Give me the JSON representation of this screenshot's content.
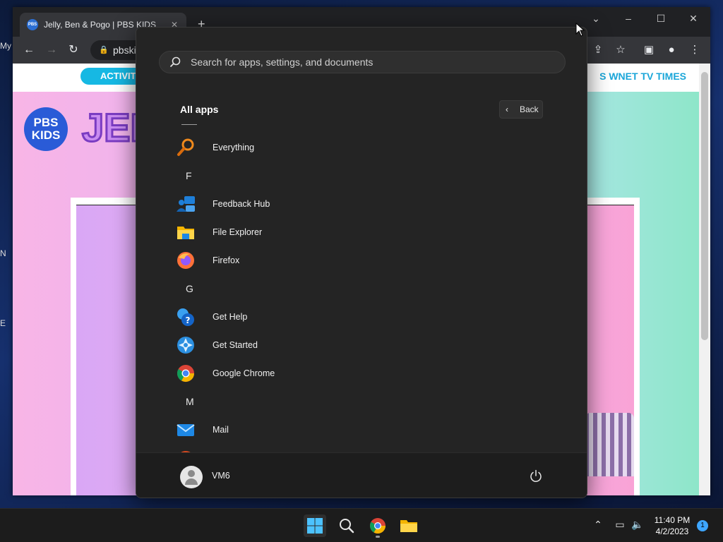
{
  "desktop": {
    "fragments": [
      "My",
      "N",
      "E"
    ]
  },
  "browser": {
    "tab_title": "Jelly, Ben & Pogo | PBS KIDS",
    "url": "pbski",
    "page": {
      "activity_pill": "ACTIVIT",
      "nav_right": "S  WNET  TV TIMES",
      "logo_text": "PBS KIDS",
      "game_title": "JELL & "
    }
  },
  "start_menu": {
    "search_placeholder": "Search for apps, settings, and documents",
    "heading": "All apps",
    "back_label": "Back",
    "apps": [
      {
        "name": "Everything",
        "icon": "magnifier-icon"
      },
      {
        "letter": "F"
      },
      {
        "name": "Feedback Hub",
        "icon": "feedback-hub-icon"
      },
      {
        "name": "File Explorer",
        "icon": "folder-icon"
      },
      {
        "name": "Firefox",
        "icon": "firefox-icon"
      },
      {
        "letter": "G"
      },
      {
        "name": "Get Help",
        "icon": "get-help-icon"
      },
      {
        "name": "Get Started",
        "icon": "get-started-icon"
      },
      {
        "name": "Google Chrome",
        "icon": "chrome-icon"
      },
      {
        "letter": "M"
      },
      {
        "name": "Mail",
        "icon": "mail-icon"
      }
    ],
    "user": "VM6"
  },
  "taskbar": {
    "time": "11:40 PM",
    "date": "4/2/2023",
    "notification_count": "1"
  }
}
